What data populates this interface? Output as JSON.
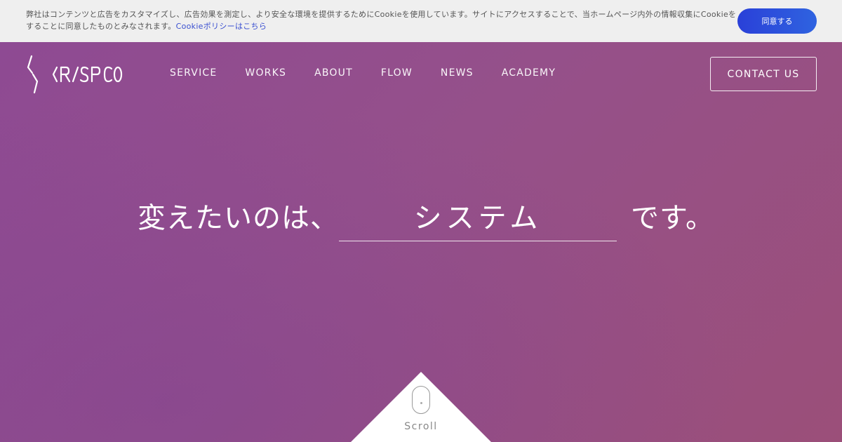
{
  "cookie_banner": {
    "text_line1": "弊社はコンテンツと広告をカスタマイズし、広告効果を測定し、より安全な環境を提供するためにCookieを使用しています。サイトにアクセスすることで、当ホームページ内外の情報収集にCookieを使用",
    "text_line2": "することに同意したものとみなされます。",
    "policy_link": "Cookieポリシーはこちら",
    "accept_label": "同意する"
  },
  "header": {
    "logo_text": "CRISPCODE",
    "nav": [
      {
        "label": "SERVICE"
      },
      {
        "label": "WORKS"
      },
      {
        "label": "ABOUT"
      },
      {
        "label": "FLOW"
      },
      {
        "label": "NEWS"
      },
      {
        "label": "ACADEMY"
      }
    ],
    "contact_label": "CONTACT US"
  },
  "hero": {
    "headline_prefix": "変えたいのは、",
    "headline_word": "システム",
    "headline_suffix": "です。",
    "scroll_label": "Scroll"
  },
  "colors": {
    "hero_gradient_start": "#8e4a93",
    "hero_gradient_end": "#9b4f79",
    "cookie_button": "#2a40d8",
    "cookie_link": "#3a4fd0"
  }
}
